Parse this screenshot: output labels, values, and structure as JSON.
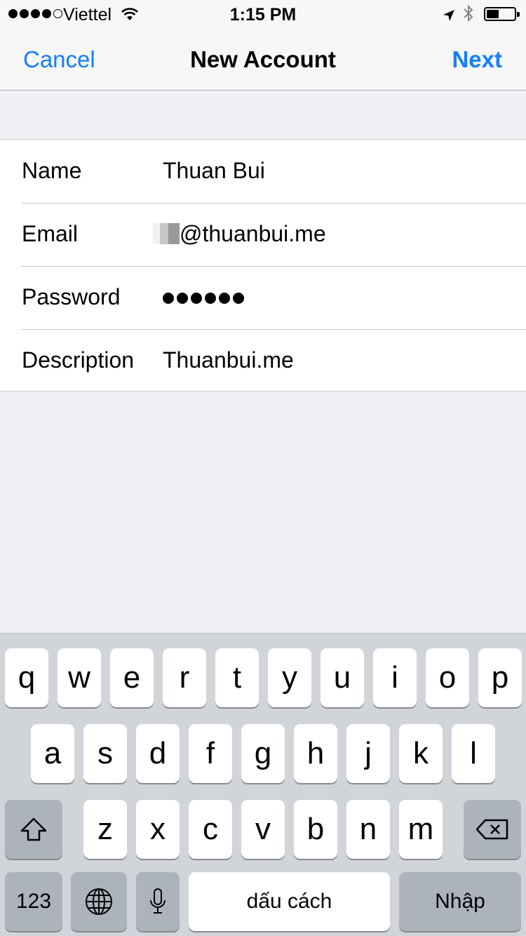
{
  "status_bar": {
    "carrier": "Viettel",
    "time": "1:15 PM",
    "signal_bars": 4,
    "battery_level": 0.35,
    "icons": [
      "wifi-icon",
      "location-arrow-icon",
      "bluetooth-icon",
      "battery-icon"
    ]
  },
  "nav": {
    "cancel_label": "Cancel",
    "title": "New Account",
    "next_label": "Next"
  },
  "form": {
    "name": {
      "label": "Name",
      "value": "Thuan Bui"
    },
    "email": {
      "label": "Email",
      "value": "@thuanbui.me"
    },
    "password": {
      "label": "Password",
      "value": "••••••"
    },
    "description": {
      "label": "Description",
      "value": "Thuanbui.me"
    }
  },
  "keyboard": {
    "row1": [
      "q",
      "w",
      "e",
      "r",
      "t",
      "y",
      "u",
      "i",
      "o",
      "p"
    ],
    "row2": [
      "a",
      "s",
      "d",
      "f",
      "g",
      "h",
      "j",
      "k",
      "l"
    ],
    "row3": [
      "z",
      "x",
      "c",
      "v",
      "b",
      "n",
      "m"
    ],
    "numbers_label": "123",
    "space_label": "dấu cách",
    "return_label": "Nhập",
    "icons": [
      "shift-icon",
      "backspace-icon",
      "globe-icon",
      "microphone-icon"
    ]
  },
  "colors": {
    "accent": "#157efb",
    "background": "#efeff4",
    "keyboard_bg": "#d1d4d9"
  }
}
